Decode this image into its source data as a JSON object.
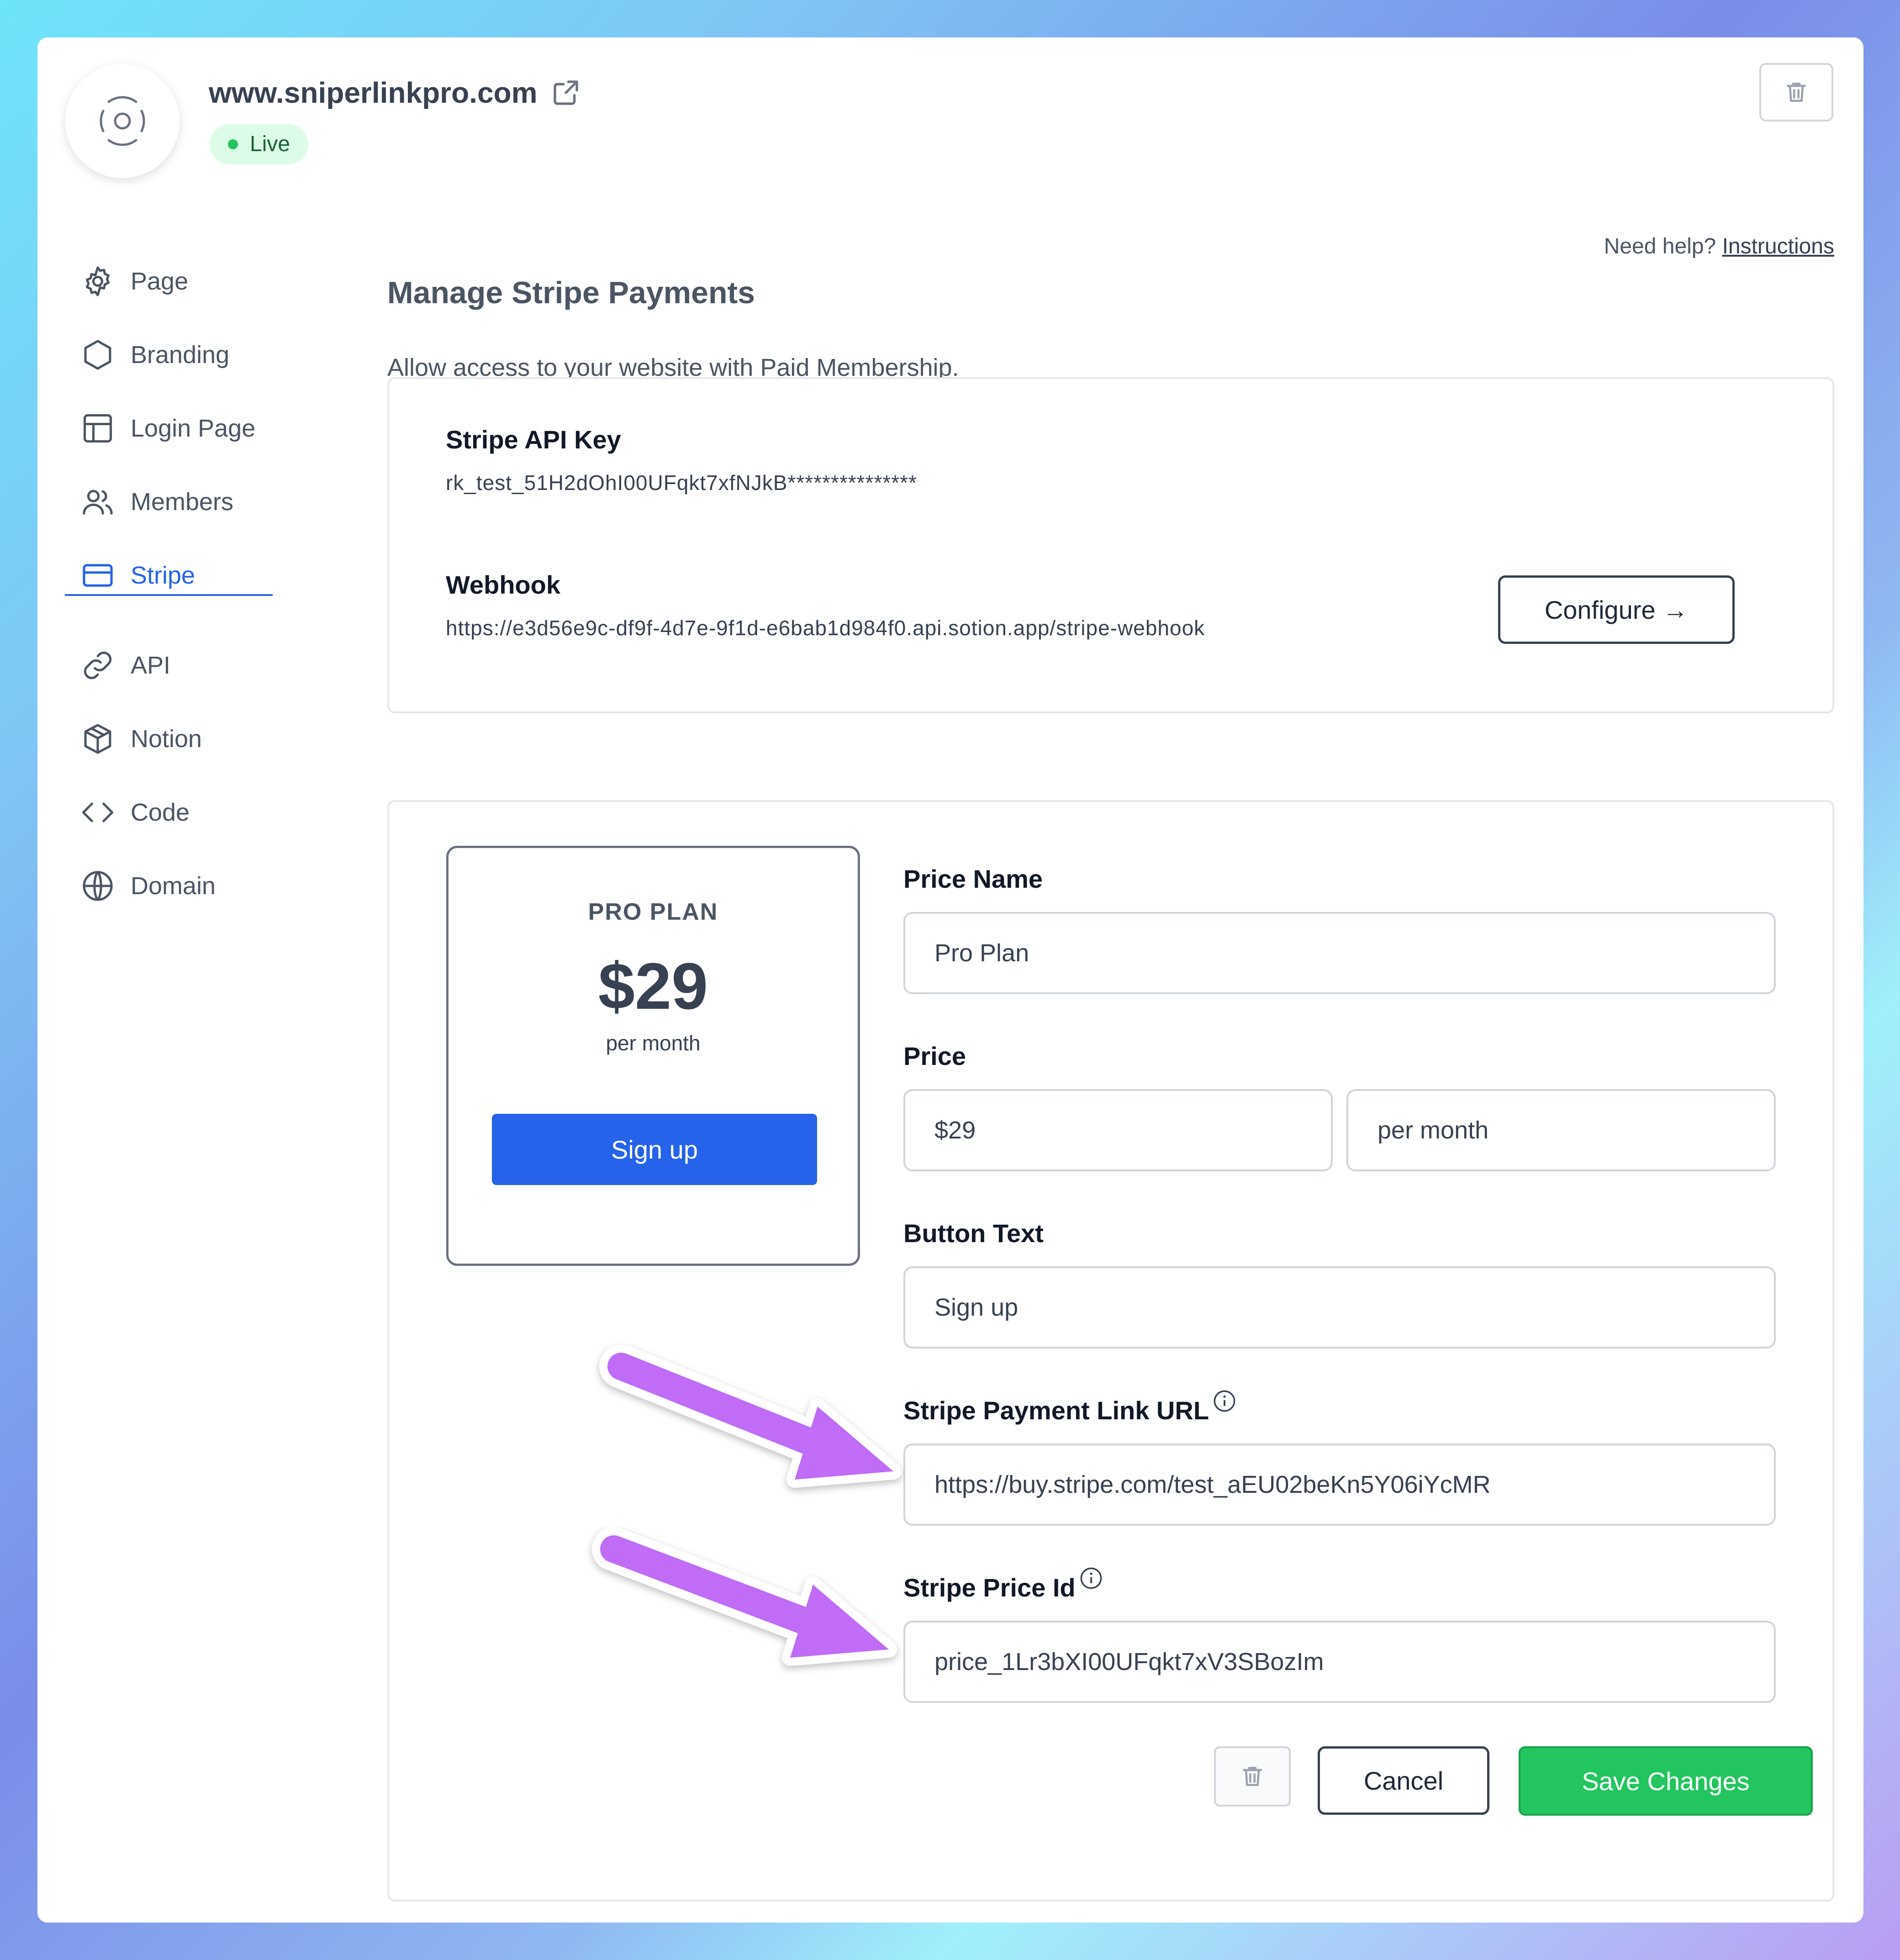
{
  "site": {
    "url": "www.sniperlinkpro.com",
    "status": "Live"
  },
  "sidebar": {
    "items": [
      {
        "label": "Page",
        "icon": "gear-icon"
      },
      {
        "label": "Branding",
        "icon": "hexagon-icon"
      },
      {
        "label": "Login Page",
        "icon": "layout-icon"
      },
      {
        "label": "Members",
        "icon": "users-icon"
      },
      {
        "label": "Stripe",
        "icon": "credit-card-icon",
        "active": true
      },
      {
        "label": "API",
        "icon": "link-icon"
      },
      {
        "label": "Notion",
        "icon": "cube-icon"
      },
      {
        "label": "Code",
        "icon": "code-icon"
      },
      {
        "label": "Domain",
        "icon": "globe-icon"
      }
    ]
  },
  "main": {
    "title": "Manage Stripe Payments",
    "help_text": "Need help?",
    "help_link": "Instructions",
    "subtitle": "Allow access to your website with Paid Membership."
  },
  "stripe": {
    "api_key_label": "Stripe API Key",
    "api_key_value": "rk_test_51H2dOhI00UFqkt7xfNJkB***************",
    "webhook_label": "Webhook",
    "webhook_value": "https://e3d56e9c-df9f-4d7e-9f1d-e6bab1d984f0.api.sotion.app/stripe-webhook",
    "configure_label": "Configure →"
  },
  "plan_preview": {
    "name": "PRO PLAN",
    "amount": "$29",
    "period": "per month",
    "button": "Sign up"
  },
  "form": {
    "price_name_label": "Price Name",
    "price_name_value": "Pro Plan",
    "price_label": "Price",
    "price_value": "$29",
    "period_value": "per month",
    "button_text_label": "Button Text",
    "button_text_value": "Sign up",
    "payment_link_label": "Stripe Payment Link URL",
    "payment_link_value": "https://buy.stripe.com/test_aEU02beKn5Y06iYcMR",
    "price_id_label": "Stripe Price Id",
    "price_id_value": "price_1Lr3bXI00UFqkt7xV3SBozIm",
    "cancel_label": "Cancel",
    "save_label": "Save Changes"
  },
  "colors": {
    "accent": "#2563eb",
    "success": "#22c55e",
    "annotation_arrow": "#c06cf6"
  }
}
